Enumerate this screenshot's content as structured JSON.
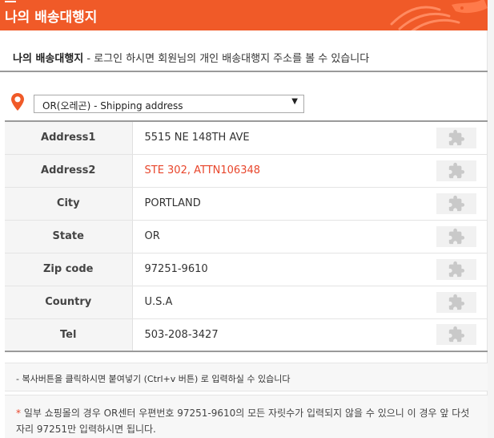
{
  "header": {
    "title": "나의 배송대행지"
  },
  "description": {
    "bold": "나의 배송대행지",
    "rest": " - 로그인 하시면 회원님의 개인 배송대행지 주소를 볼 수 있습니다"
  },
  "location": {
    "icon": "location-pin-icon",
    "selected": "OR(오레곤) - Shipping address",
    "arrow": "▼"
  },
  "address_rows": [
    {
      "label": "Address1",
      "value": "5515 NE 148TH AVE",
      "highlight": false
    },
    {
      "label": "Address2",
      "value": "STE 302, ATTN106348",
      "highlight": true
    },
    {
      "label": "City",
      "value": "PORTLAND",
      "highlight": false
    },
    {
      "label": "State",
      "value": "OR",
      "highlight": false
    },
    {
      "label": "Zip code",
      "value": "97251-9610",
      "highlight": false
    },
    {
      "label": "Country",
      "value": "U.S.A",
      "highlight": false
    },
    {
      "label": "Tel",
      "value": "503-208-3427",
      "highlight": false
    }
  ],
  "copy_icon": "puzzle-copy-icon",
  "notes": {
    "copy_hint": "- 복사버튼을 클릭하시면 붙여넣기 (Ctrl+v 버튼) 로 입력하실 수 있습니다",
    "star": "*",
    "zip_hint": " 일부 쇼핑몰의 경우 OR센터 우편번호 97251-9610의 모든 자릿수가 입력되지 않을 수 있으니 이 경우 앞 다섯자리 97251만 입력하시면 됩니다."
  },
  "colors": {
    "accent": "#f05a28",
    "highlight_text": "#e8462c",
    "label_bg": "#f5f5f5"
  }
}
